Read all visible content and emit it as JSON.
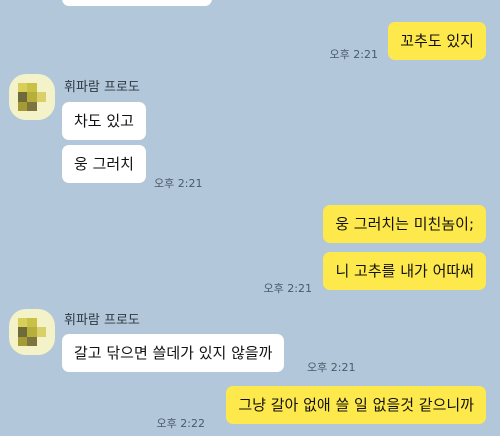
{
  "messages": {
    "m1": {
      "text": "꼬추도 있지",
      "time": "오후 2:21"
    },
    "sender1": "휘파람 프로도",
    "m2": {
      "text": "차도 있고"
    },
    "m3": {
      "text": "웅 그러치",
      "time": "오후 2:21"
    },
    "m4": {
      "text": "웅 그러치는 미친놈이;"
    },
    "m5": {
      "text": "니 고추를 내가 어따써",
      "time": "오후 2:21"
    },
    "sender2": "휘파람 프로도",
    "m6": {
      "text": "갈고 닦으면 쓸데가 있지 않을까",
      "time": "오후 2:21"
    },
    "m7": {
      "text": "그냥 갈아 없애 쓸 일 없을것 같으니까",
      "time": "오후 2:22"
    }
  },
  "colors": {
    "background": "#b2c7d9",
    "my_bubble": "#fee94c",
    "their_bubble": "#ffffff"
  }
}
